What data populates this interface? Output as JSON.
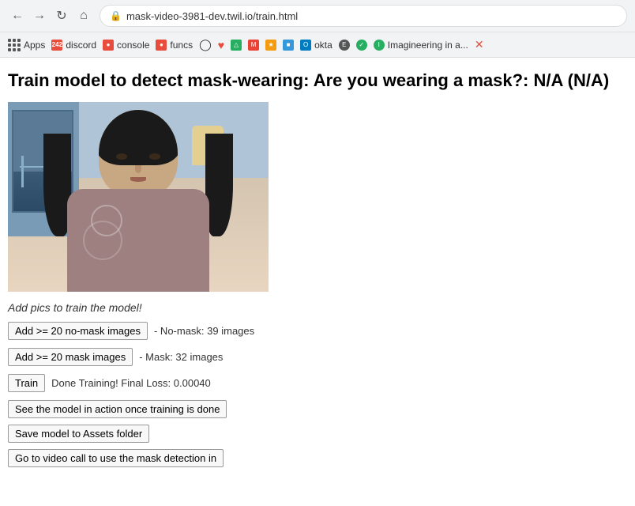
{
  "browser": {
    "url": "mask-video-3981-dev.twil.io/train.html",
    "nav": {
      "back_disabled": false,
      "forward_disabled": false
    },
    "bookmarks": [
      {
        "id": "apps",
        "label": "Apps",
        "icon_class": "apps-grid-icon"
      },
      {
        "id": "242",
        "label": "242",
        "icon_class": "bm-242"
      },
      {
        "id": "discord",
        "label": "discord",
        "icon_class": "bm-discord"
      },
      {
        "id": "console",
        "label": "console",
        "icon_class": "bm-console"
      },
      {
        "id": "funcs",
        "label": "funcs",
        "icon_class": "bm-funcs"
      },
      {
        "id": "github",
        "label": "",
        "icon_class": ""
      },
      {
        "id": "heart",
        "label": "",
        "icon_class": "bm-heart"
      },
      {
        "id": "gdrive",
        "label": "",
        "icon_class": "bm-green"
      },
      {
        "id": "gmail",
        "label": "",
        "icon_class": "bm-gmail"
      },
      {
        "id": "ext1",
        "label": "",
        "icon_class": "bm-orange"
      },
      {
        "id": "ext2",
        "label": "",
        "icon_class": "bm-blue"
      },
      {
        "id": "okta",
        "label": "okta",
        "icon_class": "bm-okta"
      },
      {
        "id": "ext3",
        "label": "E",
        "icon_class": "bm-e"
      },
      {
        "id": "ext4",
        "label": "",
        "icon_class": "bm-green2"
      },
      {
        "id": "imagineering",
        "label": "Imagineering in a...",
        "icon_class": ""
      }
    ]
  },
  "page": {
    "title": "Train model to detect mask-wearing: Are you wearing a mask?: N/A (N/A)",
    "instruction": "Add pics to train the model!",
    "buttons": {
      "no_mask": "Add >= 20 no-mask images",
      "mask": "Add >= 20 mask images",
      "train": "Train",
      "see_model": "See the model in action once training is done",
      "save_model": "Save model to Assets folder",
      "go_video": "Go to video call to use the mask detection in"
    },
    "stats": {
      "no_mask": "- No-mask: 39 images",
      "mask": "- Mask: 32 images",
      "training": "Done Training! Final Loss: 0.00040"
    }
  }
}
